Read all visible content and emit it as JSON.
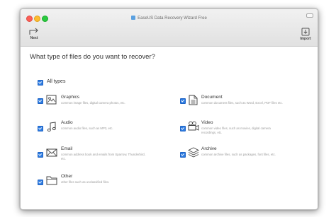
{
  "window": {
    "title": "EaseUS Data Recovery Wizard Free"
  },
  "toolbar": {
    "next_label": "Next",
    "import_label": "Import"
  },
  "main": {
    "question": "What type of files do you want to recover?",
    "all_types_label": "All types",
    "types": [
      {
        "name": "Graphics",
        "description": "common image files, digital camera photos, etc.",
        "icon": "image-icon",
        "checked": true
      },
      {
        "name": "Document",
        "description": "common document files, such as Word, Excel, PDF files etc.",
        "icon": "document-icon",
        "checked": true
      },
      {
        "name": "Audio",
        "description": "common audio files, such as MP3, etc.",
        "icon": "music-note-icon",
        "checked": true
      },
      {
        "name": "Video",
        "description": "common video files, such as movies, digital camera recordings, etc.",
        "icon": "video-camera-icon",
        "checked": true
      },
      {
        "name": "Email",
        "description": "common address book and emails from Sparrow, Thunderbird, etc.",
        "icon": "envelope-icon",
        "checked": true
      },
      {
        "name": "Archive",
        "description": "common archive files, such as packages, font files, etc.",
        "icon": "layers-icon",
        "checked": true
      },
      {
        "name": "Other",
        "description": "other files such as unclassified files.",
        "icon": "folder-icon",
        "checked": true
      }
    ]
  },
  "colors": {
    "checkbox_accent": "#2f7de1",
    "titlebar": "#e6e6e6"
  }
}
